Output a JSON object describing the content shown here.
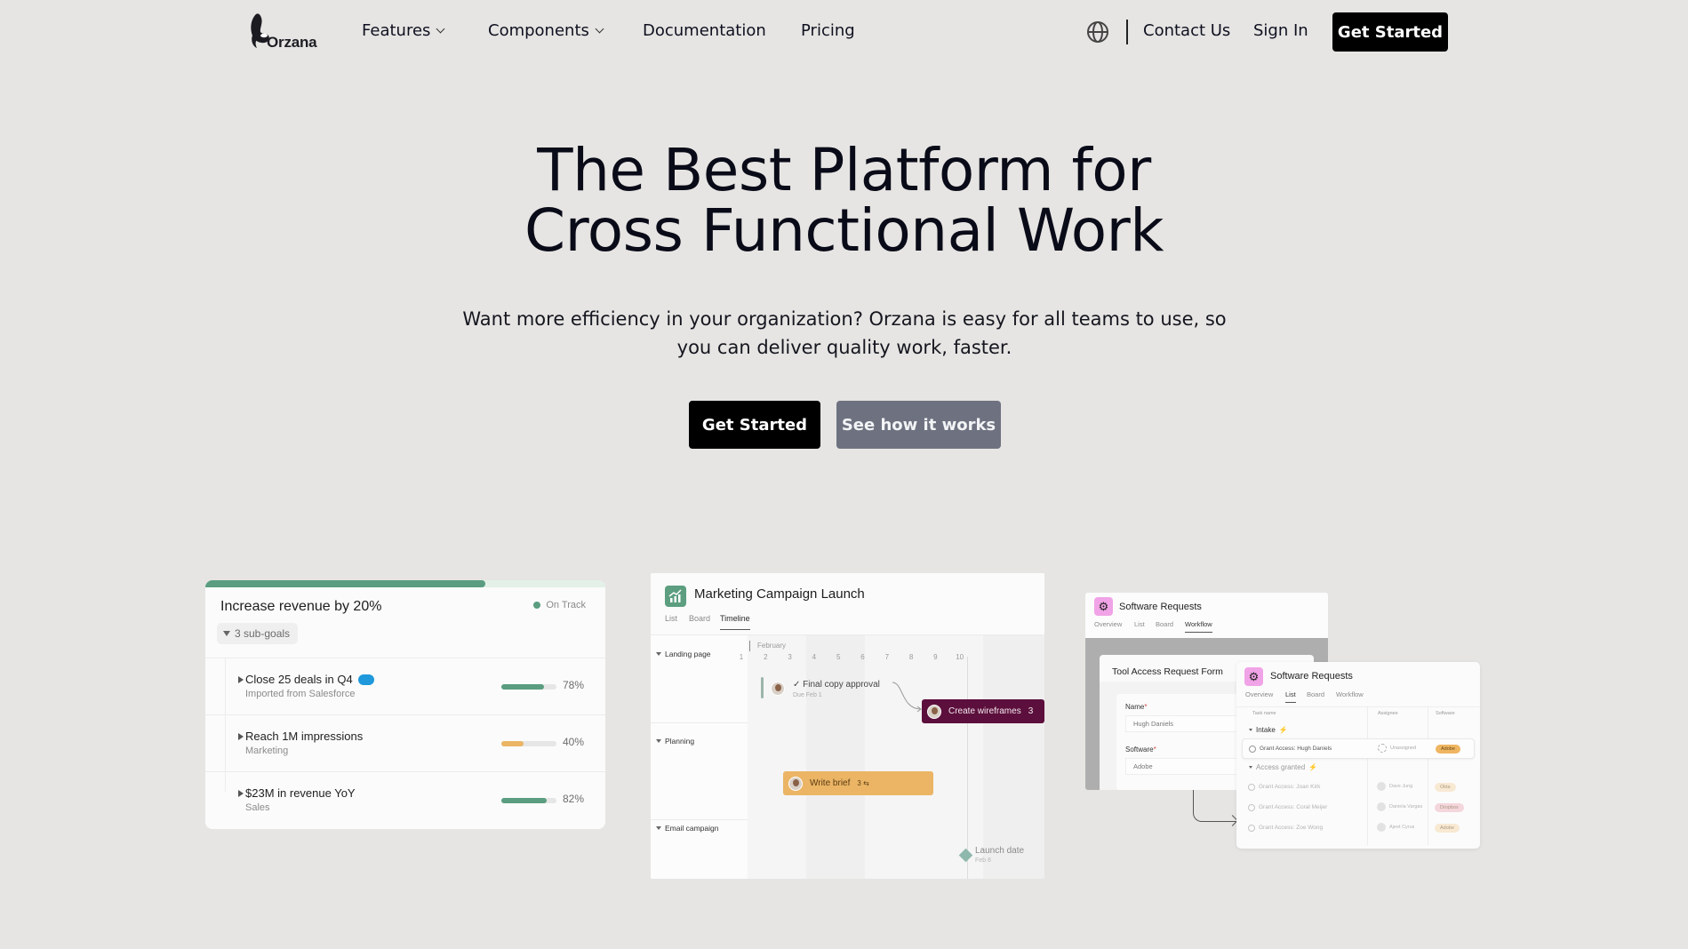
{
  "nav": {
    "logo_text": "Orzana",
    "links": [
      {
        "label": "Features",
        "has_dropdown": true
      },
      {
        "label": "Components",
        "has_dropdown": true
      },
      {
        "label": "Documentation",
        "has_dropdown": false
      },
      {
        "label": "Pricing",
        "has_dropdown": false
      }
    ],
    "language_icon": "globe-icon",
    "contact_label": "Contact Us",
    "signin_label": "Sign In",
    "cta_label": "Get Started"
  },
  "hero": {
    "title_line1": "The Best Platform for",
    "title_line2": "Cross Functional Work",
    "subtitle": "Want more efficiency in your organization? Orzana is easy for all teams to use, so you can deliver quality work, faster.",
    "primary_label": "Get Started",
    "secondary_label": "See how it works"
  },
  "colors": {
    "page_bg": "#e6e5e3",
    "primary_button": "#000000",
    "secondary_button": "#6e7280",
    "goal_green": "#5a9d80",
    "goal_yellow": "#ebb565",
    "wireframes_purple": "#5c0f3c",
    "software_pink": "#f1a3e7"
  },
  "goals_card": {
    "title": "Increase revenue by 20%",
    "status": "On Track",
    "overall_progress_percent": 70,
    "subgoals_label": "3 sub-goals",
    "rows": [
      {
        "name": "Close 25 deals in Q4",
        "sub": "Imported from Salesforce",
        "percent": 78,
        "percent_label": "78%",
        "color": "#5a9d80",
        "salesforce_icon": true
      },
      {
        "name": "Reach 1M impressions",
        "sub": "Marketing",
        "percent": 40,
        "percent_label": "40%",
        "color": "#ebb565",
        "salesforce_icon": false
      },
      {
        "name": "$23M in revenue YoY",
        "sub": "Sales",
        "percent": 82,
        "percent_label": "82%",
        "color": "#5a9d80",
        "salesforce_icon": false
      }
    ]
  },
  "timeline_card": {
    "title": "Marketing Campaign Launch",
    "tabs": [
      "List",
      "Board",
      "Timeline"
    ],
    "active_tab": "Timeline",
    "month": "February",
    "days": [
      "1",
      "2",
      "3",
      "4",
      "5",
      "6",
      "7",
      "8",
      "9",
      "10"
    ],
    "sections": [
      "Landing page",
      "Planning",
      "Email campaign"
    ],
    "tasks": {
      "final_copy": {
        "title": "✓ Final copy approval",
        "due": "Due Feb 1"
      },
      "wireframes": {
        "title": "Create wireframes",
        "count": "3"
      },
      "brief": {
        "title": "Write brief",
        "subtasks": "3 ⇆"
      },
      "launch": {
        "title": "Launch date",
        "date": "Feb 8"
      }
    }
  },
  "workflow_card": {
    "title": "Software Requests",
    "tabs": [
      "Overview",
      "List",
      "Board",
      "Workflow"
    ],
    "active_tab": "Workflow",
    "form": {
      "title": "Tool Access Request Form",
      "fields": [
        {
          "label": "Name",
          "value": "Hugh Daniels"
        },
        {
          "label": "Software",
          "value": "Adobe"
        }
      ]
    }
  },
  "list_card": {
    "title": "Software Requests",
    "tabs": [
      "Overview",
      "List",
      "Board",
      "Workflow"
    ],
    "active_tab": "List",
    "columns": [
      "Task name",
      "Assignee",
      "Software"
    ],
    "groups": [
      {
        "name": "Intake",
        "rows": [
          {
            "task": "Grant Access: Hugh Daniels",
            "assignee": "Unassigned",
            "software": "Adobe",
            "tag_color": "#efb560"
          }
        ]
      },
      {
        "name": "Access granted",
        "rows": [
          {
            "task": "Grant Access: Joan Kirk",
            "assignee": "Dave Jung",
            "software": "Okta",
            "tag_color": "#f7dcb4"
          },
          {
            "task": "Grant Access: Coral Meijer",
            "assignee": "Daniela Vargas",
            "software": "Dropbox",
            "tag_color": "#f0b8c6"
          },
          {
            "task": "Grant Access: Zoe Wong",
            "assignee": "Ajeet Cyrus",
            "software": "Adobe",
            "tag_color": "#f7dcb4"
          }
        ]
      }
    ]
  }
}
